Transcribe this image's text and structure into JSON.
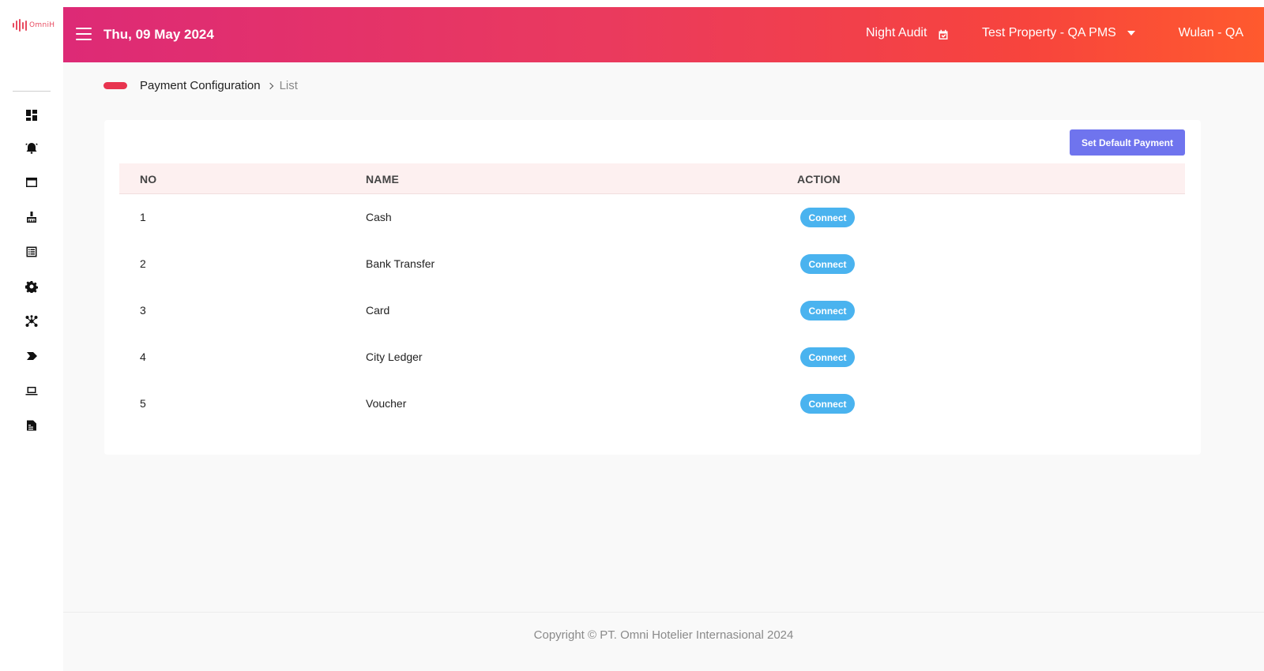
{
  "brand": {
    "logo_text": "OmniH",
    "accent": "#e84a5f"
  },
  "sidebar": {
    "icons": [
      {
        "icon": "dashboard-icon"
      },
      {
        "icon": "alarm-icon"
      },
      {
        "icon": "window-icon"
      },
      {
        "icon": "housekeeping-icon"
      },
      {
        "icon": "list-icon"
      },
      {
        "icon": "gear-icon"
      },
      {
        "icon": "network-icon"
      },
      {
        "icon": "label-icon"
      },
      {
        "icon": "laptop-icon"
      },
      {
        "icon": "report-icon"
      }
    ]
  },
  "header": {
    "date": "Thu, 09 May 2024",
    "night_audit": "Night Audit",
    "property": "Test Property - QA PMS",
    "user": "Wulan - QA"
  },
  "breadcrumb": {
    "parent": "Payment Configuration",
    "current": "List"
  },
  "actions": {
    "set_default_payment": "Set Default Payment"
  },
  "table": {
    "headers": {
      "no": "NO",
      "name": "NAME",
      "action": "ACTION"
    },
    "rows": [
      {
        "no": "1",
        "name": "Cash",
        "action": "Connect"
      },
      {
        "no": "2",
        "name": "Bank Transfer",
        "action": "Connect"
      },
      {
        "no": "3",
        "name": "Card",
        "action": "Connect"
      },
      {
        "no": "4",
        "name": "City Ledger",
        "action": "Connect"
      },
      {
        "no": "5",
        "name": "Voucher",
        "action": "Connect"
      }
    ]
  },
  "footer": {
    "copyright": "Copyright © PT. Omni Hotelier Internasional 2024"
  },
  "colors": {
    "header_gradient_start": "#dd2a76",
    "header_gradient_end": "#ff5a2e",
    "primary_button": "#6f74ee",
    "connect_button": "#4ab3ef",
    "table_header_bg": "#fdf0f0"
  }
}
